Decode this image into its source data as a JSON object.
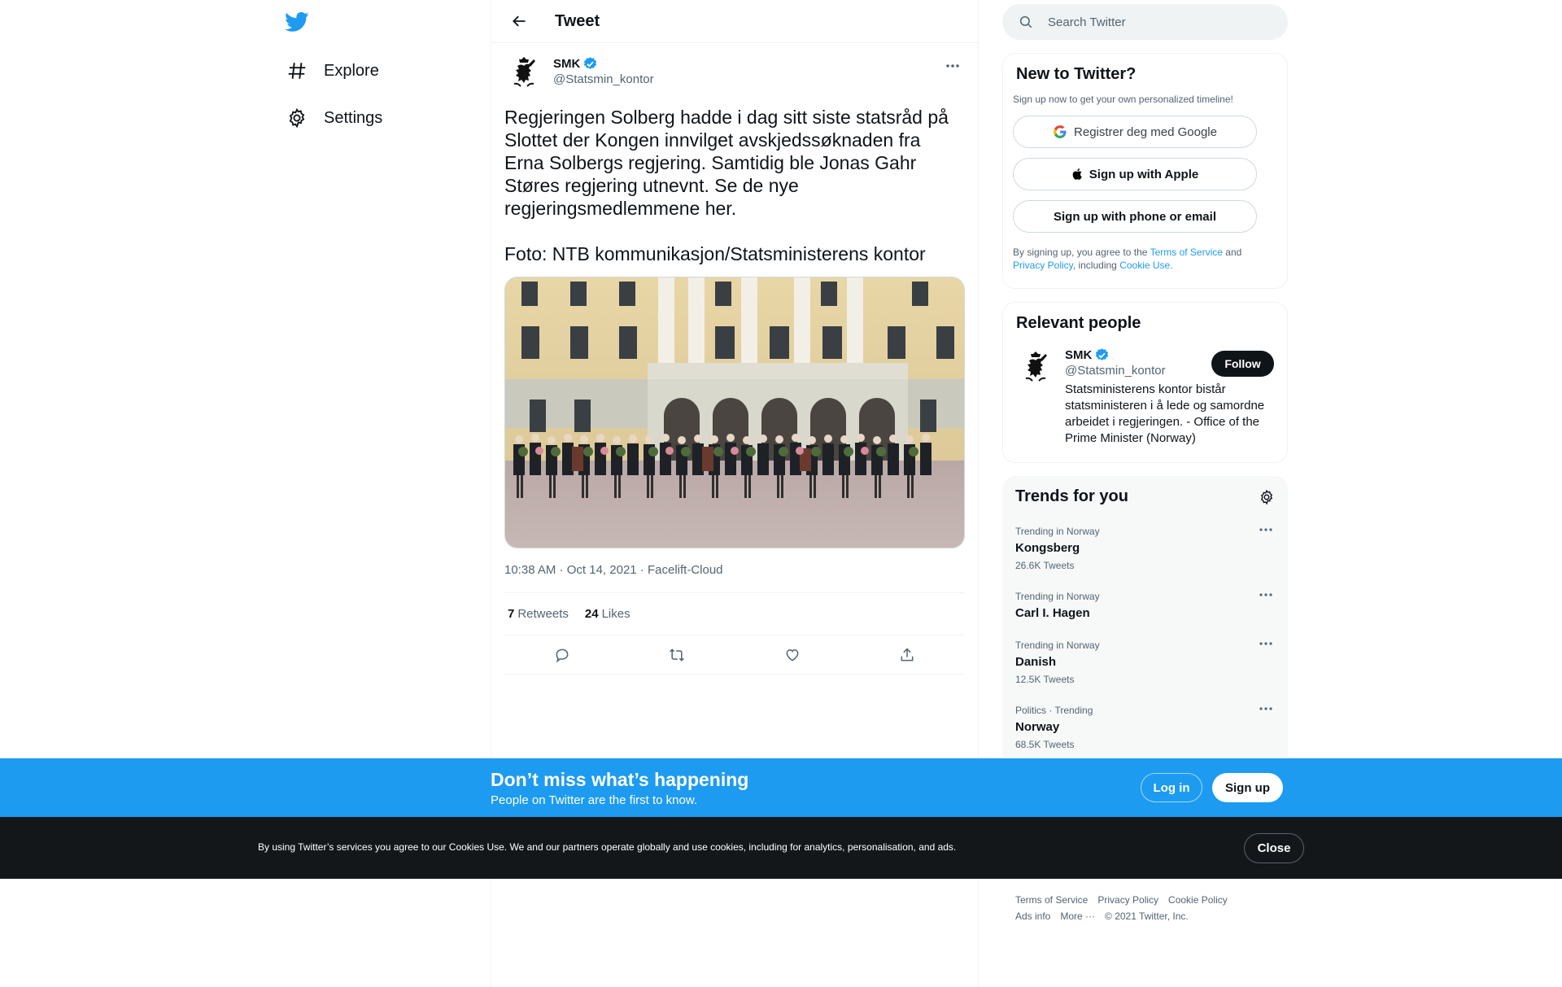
{
  "nav": {
    "items": [
      {
        "label": "Explore",
        "icon": "hashtag-icon"
      },
      {
        "label": "Settings",
        "icon": "gear-icon"
      }
    ]
  },
  "header": {
    "title": "Tweet"
  },
  "tweet": {
    "author": {
      "name": "SMK",
      "handle": "@Statsmin_kontor",
      "verified": true
    },
    "text": "Regjeringen Solberg hadde i dag sitt siste statsråd på Slottet der Kongen innvilget avskjedssøknaden fra Erna Solbergs regjering. Samtidig ble Jonas Gahr Støres regjering utnevnt. Se de nye regjeringsmedlemmene her.\n\nFoto: NTB kommunikasjon/Statsministerens kontor",
    "time": "10:38 AM",
    "date": "Oct 14, 2021",
    "source": "Facelift-Cloud",
    "retweets": {
      "count": "7",
      "label": "Retweets"
    },
    "likes": {
      "count": "24",
      "label": "Likes"
    }
  },
  "search": {
    "placeholder": "Search Twitter"
  },
  "signup_card": {
    "title": "New to Twitter?",
    "subtitle": "Sign up now to get your own personalized timeline!",
    "google_label": "Registrer deg med Google",
    "apple_label": "Sign up with Apple",
    "phone_label": "Sign up with phone or email",
    "legal_prefix": "By signing up, you agree to the",
    "tos": "Terms of Service",
    "and": "and",
    "privacy": "Privacy Policy",
    "including": ", including",
    "cookie": "Cookie Use."
  },
  "relevant": {
    "title": "Relevant people",
    "person": {
      "name": "SMK",
      "handle": "@Statsmin_kontor",
      "bio": "Statsministerens kontor bistår statsministeren i å lede og samordne arbeidet i regjeringen. - Office of the Prime Minister (Norway)",
      "follow_label": "Follow"
    }
  },
  "trends": {
    "title": "Trends for you",
    "items": [
      {
        "context": "Trending in Norway",
        "name": "Kongsberg",
        "count": "26.6K Tweets"
      },
      {
        "context": "Trending in Norway",
        "name": "Carl I. Hagen",
        "count": ""
      },
      {
        "context": "Trending in Norway",
        "name": "Danish",
        "count": "12.5K Tweets"
      },
      {
        "context": "Politics · Trending",
        "name": "Norway",
        "count": "68.5K Tweets"
      }
    ]
  },
  "footer": {
    "links": [
      "Terms of Service",
      "Privacy Policy",
      "Cookie Policy",
      "Ads info",
      "More ···"
    ],
    "copyright": "© 2021 Twitter, Inc."
  },
  "promo": {
    "title": "Don’t miss what’s happening",
    "subtitle": "People on Twitter are the first to know.",
    "login_label": "Log in",
    "signup_label": "Sign up"
  },
  "cookie_bar": {
    "text": "By using Twitter’s services you agree to our Cookies Use. We and our partners operate globally and use cookies, including for analytics, personalisation, and ads.",
    "close_label": "Close"
  },
  "colors": {
    "brand": "#1d9bf0",
    "text": "#0f1419",
    "secondary": "#536471",
    "cookie_bg": "#14171a"
  }
}
